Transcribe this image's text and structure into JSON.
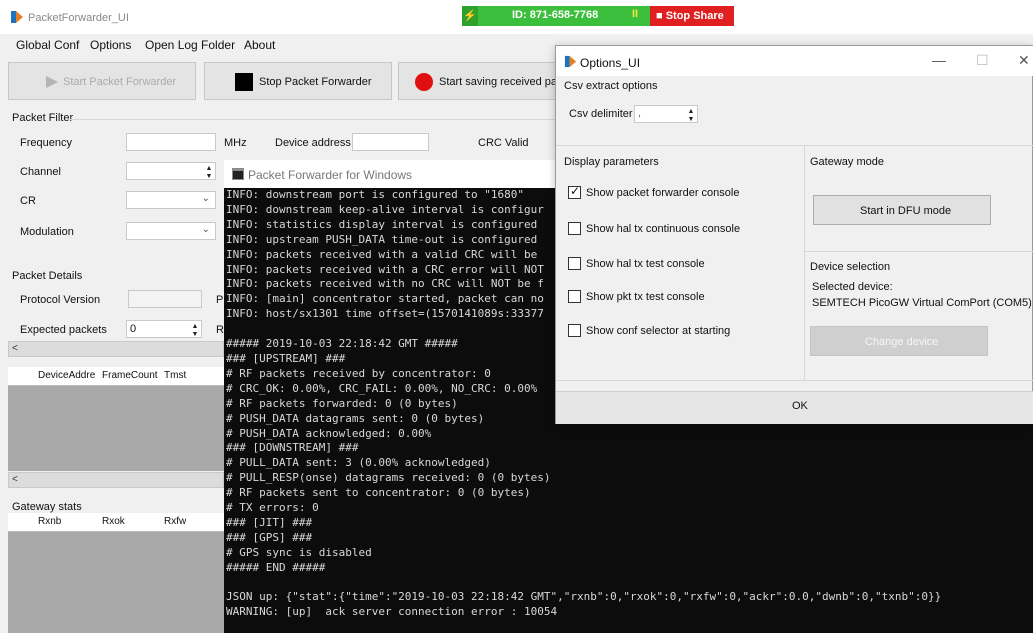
{
  "app": {
    "title": "PacketForwarder_UI"
  },
  "share": {
    "id_text": "ID: 871-658-7768",
    "pause_glyph": "II",
    "stop_label": "Stop Share",
    "colors": {
      "bar": "#3cbf3c",
      "stop": "#e02020"
    }
  },
  "menu": {
    "items": [
      "Global Conf",
      "Options",
      "Open Log Folder",
      "About"
    ]
  },
  "toolbar": {
    "start_label": "Start Packet Forwarder",
    "stop_label": "Stop Packet Forwarder",
    "save_label": "Start saving received packe"
  },
  "packet_filter": {
    "title": "Packet Filter",
    "frequency_label": "Frequency",
    "frequency_value": "",
    "frequency_unit": "MHz",
    "device_address_label": "Device address",
    "device_address_value": "",
    "crc_label": "CRC Valid",
    "channel_label": "Channel",
    "channel_value": "",
    "cr_label": "CR",
    "cr_value": "",
    "modulation_label": "Modulation",
    "modulation_value": ""
  },
  "packet_details": {
    "title": "Packet Details",
    "protocol_version_label": "Protocol Version",
    "protocol_version_value": "",
    "protocol_suffix": "P",
    "expected_packets_label": "Expected packets",
    "expected_packets_value": "0",
    "expected_suffix": "R"
  },
  "device_grid": {
    "columns": [
      "DeviceAddre",
      "FrameCount",
      "Tmst"
    ]
  },
  "gateway_stats": {
    "title": "Gateway stats",
    "columns": [
      "Rxnb",
      "Rxok",
      "Rxfw"
    ]
  },
  "console": {
    "title": "Packet Forwarder for Windows",
    "lines": [
      "INFO: downstream port is configured to \"1680\"",
      "INFO: downstream keep-alive interval is configur",
      "INFO: statistics display interval is configured",
      "INFO: upstream PUSH_DATA time-out is configured",
      "INFO: packets received with a valid CRC will be",
      "INFO: packets received with a CRC error will NOT",
      "INFO: packets received with no CRC will NOT be f",
      "INFO: [main] concentrator started, packet can no",
      "INFO: host/sx1301 time offset=(1570141089s:33377",
      "",
      "##### 2019-10-03 22:18:42 GMT #####",
      "### [UPSTREAM] ###",
      "# RF packets received by concentrator: 0",
      "# CRC_OK: 0.00%, CRC_FAIL: 0.00%, NO_CRC: 0.00%",
      "# RF packets forwarded: 0 (0 bytes)",
      "# PUSH_DATA datagrams sent: 0 (0 bytes)",
      "# PUSH_DATA acknowledged: 0.00%",
      "### [DOWNSTREAM] ###",
      "# PULL_DATA sent: 3 (0.00% acknowledged)",
      "# PULL_RESP(onse) datagrams received: 0 (0 bytes)",
      "# RF packets sent to concentrator: 0 (0 bytes)",
      "# TX errors: 0",
      "### [JIT] ###",
      "### [GPS] ###",
      "# GPS sync is disabled",
      "##### END #####",
      "",
      "JSON up: {\"stat\":{\"time\":\"2019-10-03 22:18:42 GMT\",\"rxnb\":0,\"rxok\":0,\"rxfw\":0,\"ackr\":0.0,\"dwnb\":0,\"txnb\":0}}",
      "WARNING: [up]  ack server connection error : 10054"
    ]
  },
  "options": {
    "title": "Options_UI",
    "csv_title": "Csv extract options",
    "csv_delimiter_label": "Csv delimiter",
    "csv_delimiter_value": ",",
    "display_title": "Display parameters",
    "checkboxes": [
      {
        "label": "Show packet forwarder console",
        "checked": true
      },
      {
        "label": "Show hal tx continuous console",
        "checked": false
      },
      {
        "label": "Show hal tx test console",
        "checked": false
      },
      {
        "label": "Show pkt tx test console",
        "checked": false
      },
      {
        "label": "Show conf selector at starting",
        "checked": false
      }
    ],
    "gateway_mode_title": "Gateway mode",
    "dfu_button": "Start in DFU mode",
    "device_selection_title": "Device selection",
    "selected_device_label": "Selected device:",
    "selected_device_value": "SEMTECH PicoGW Virtual ComPort (COM5)",
    "change_device_button": "Change device",
    "ok_button": "OK"
  }
}
